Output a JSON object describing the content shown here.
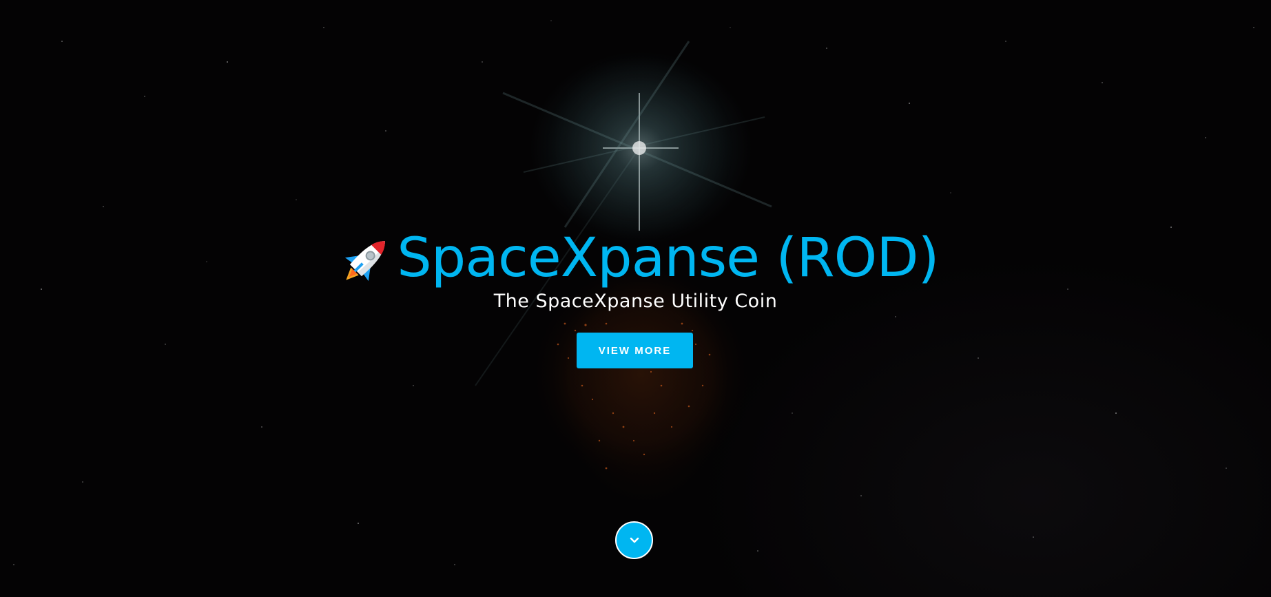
{
  "hero": {
    "title": "SpaceXpanse (ROD)",
    "subtitle": "The SpaceXpanse Utility Coin",
    "rocket_icon": "rocket-icon",
    "cta_label": "VIEW MORE",
    "scroll_icon": "chevron-down-icon"
  },
  "colors": {
    "accent": "#00b6f1",
    "background": "#040304",
    "text": "#ffffff"
  }
}
